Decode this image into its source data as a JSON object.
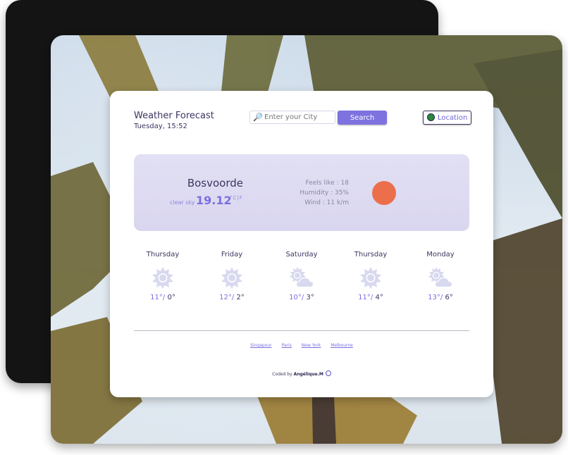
{
  "header": {
    "title": "Weather Forecast",
    "date": "Tuesday, 15:52"
  },
  "search": {
    "icon": "magnifier-icon",
    "placeholder": "Enter your City",
    "value": "",
    "button_label": "Search"
  },
  "location": {
    "icon": "globe-icon",
    "label": "Location"
  },
  "current": {
    "city": "Bosvoorde",
    "description": "clear sky",
    "temperature": "19.12",
    "units": "°C|F",
    "feels_like": "Feels like : 18",
    "humidity": "Humidity : 35%",
    "wind": "Wind : 11 k/m",
    "icon": "sun-icon",
    "icon_color": "#ec6f4c"
  },
  "forecast": [
    {
      "day": "Thursday",
      "icon": "sun-icon",
      "high": "11°/",
      "low": "0°"
    },
    {
      "day": "Friday",
      "icon": "sun-icon",
      "high": "12°/",
      "low": "2°"
    },
    {
      "day": "Saturday",
      "icon": "partly-cloudy-icon",
      "high": "10°/",
      "low": "3°"
    },
    {
      "day": "Thursday",
      "icon": "sun-icon",
      "high": "11°/",
      "low": "4°"
    },
    {
      "day": "Monday",
      "icon": "partly-cloudy-icon",
      "high": "13°/",
      "low": "6°"
    }
  ],
  "quick_cities": [
    "Singapour",
    "Paris",
    "New York",
    "Melbourne"
  ],
  "footer": {
    "coded_by": "Coded by",
    "author": "Angélique.M",
    "icon": "github-icon"
  },
  "colors": {
    "accent": "#7d72e0",
    "text": "#3d3560",
    "panel": "#dedcf2"
  }
}
